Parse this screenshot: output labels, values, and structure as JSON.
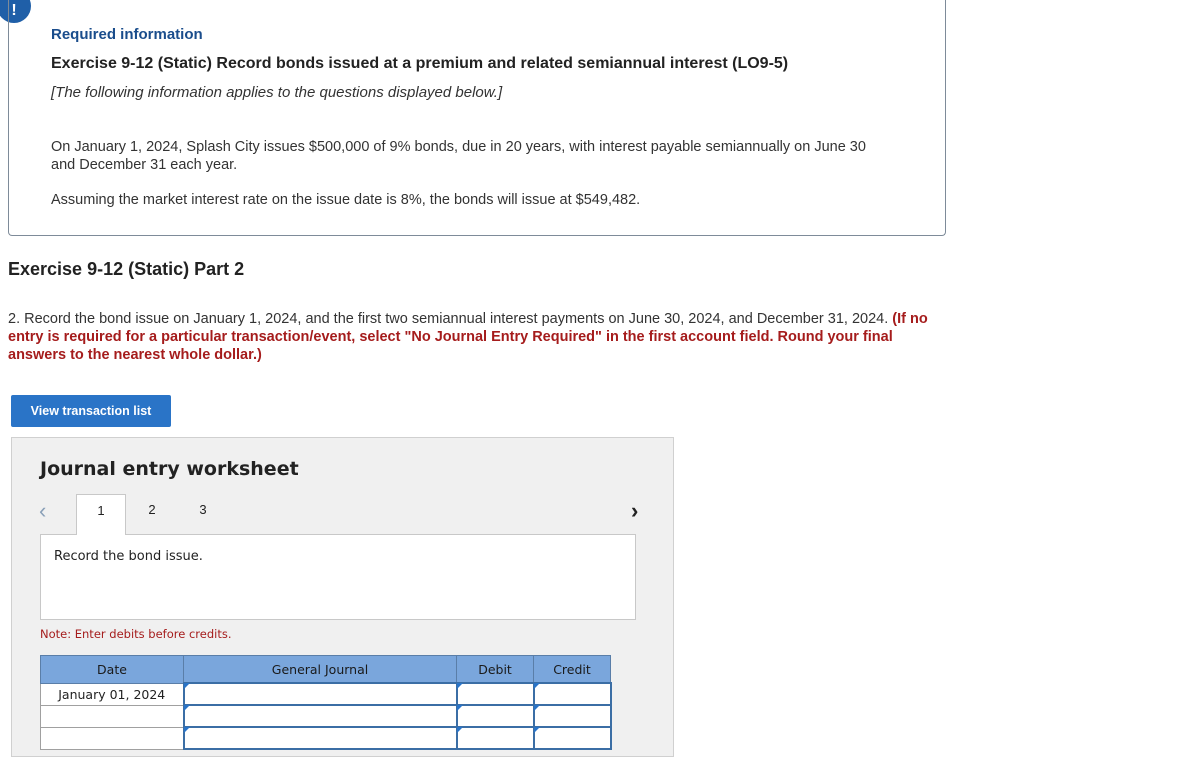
{
  "alert": {
    "symbol": "!"
  },
  "info": {
    "required_label": "Required information",
    "exercise_title": "Exercise 9-12 (Static) Record bonds issued at a premium and related semiannual interest (LO9-5)",
    "applies_text": "[The following information applies to the questions displayed below.]",
    "para1": "On January 1, 2024, Splash City issues $500,000 of 9% bonds, due in 20 years, with interest payable semiannually on June 30 and December 31 each year.",
    "para2": "Assuming the market interest rate on the issue date is 8%, the bonds will issue at $549,482."
  },
  "part": {
    "title": "Exercise 9-12 (Static) Part 2"
  },
  "question": {
    "text": "2. Record the bond issue on January 1, 2024, and the first two semiannual interest payments on June 30, 2024, and December 31, 2024. ",
    "instruction": "(If no entry is required for a particular transaction/event, select \"No Journal Entry Required\" in the first account field. Round your final answers to the nearest whole dollar.)"
  },
  "buttons": {
    "view_transactions": "View transaction list"
  },
  "worksheet": {
    "title": "Journal entry worksheet",
    "prev_icon": "‹",
    "next_icon": "›",
    "tabs": [
      "1",
      "2",
      "3"
    ],
    "active_tab": 0,
    "task": "Record the bond issue.",
    "note": "Note: Enter debits before credits.",
    "columns": [
      "Date",
      "General Journal",
      "Debit",
      "Credit"
    ],
    "rows": [
      {
        "date": "January 01, 2024"
      },
      {
        "date": ""
      },
      {
        "date": ""
      }
    ]
  }
}
